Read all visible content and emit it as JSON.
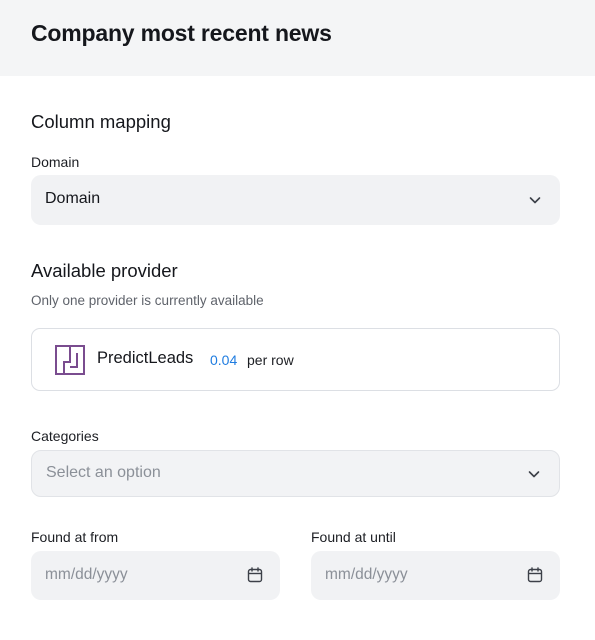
{
  "header": {
    "title": "Company most recent news"
  },
  "column_mapping": {
    "title": "Column mapping",
    "domain_label": "Domain",
    "domain_value": "Domain"
  },
  "provider": {
    "title": "Available provider",
    "hint": "Only one provider is currently available",
    "name": "PredictLeads",
    "price": "0.04",
    "unit": "per row",
    "logo_color": "#7a4c8f"
  },
  "categories": {
    "label": "Categories",
    "placeholder": "Select an option"
  },
  "found_from": {
    "label": "Found at from",
    "placeholder": "mm/dd/yyyy"
  },
  "found_until": {
    "label": "Found at until",
    "placeholder": "mm/dd/yyyy"
  },
  "colors": {
    "header_bg": "#f4f5f6",
    "field_bg": "#f1f2f4",
    "accent": "#1f7ce0"
  },
  "icons": [
    "chevron-down-icon",
    "predictleads-logo-icon",
    "calendar-icon"
  ]
}
